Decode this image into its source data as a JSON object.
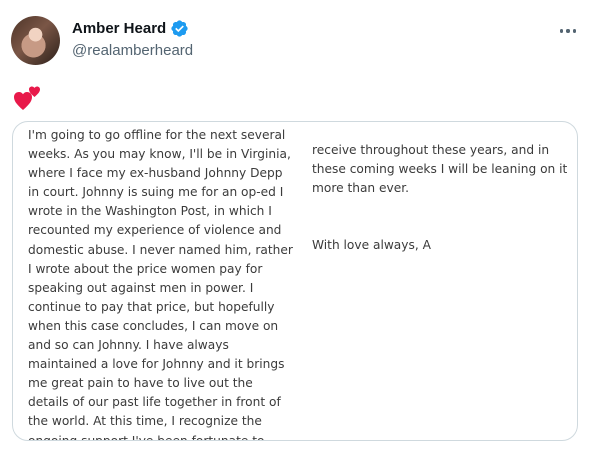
{
  "tweet": {
    "author": {
      "display_name": "Amber Heard",
      "handle": "@realamberheard",
      "verified": true,
      "verified_color": "#1d9bf0"
    },
    "text_icon": "two-hearts-icon",
    "more_icon": "more-options-icon",
    "statement": {
      "left_column": "I'm going to go offline for the next several\nweeks. As you may know,  I'll be in Virginia,\nwhere I face my ex-husband Johnny Depp\nin court. Johnny is suing me for an op-ed I\nwrote in the Washington Post, in which I\nrecounted my experience of violence and\ndomestic abuse. I never named him, rather\nI wrote about the price women pay for\nspeaking out against men in power. I\ncontinue to pay that price, but hopefully\nwhen this case concludes, I can move on\nand so can Johnny. I have always\nmaintained a love for Johnny and it brings\nme great pain to have to live out the\ndetails of our past life together in front of\nthe world. At this time, I recognize the\nongoing support I've been fortunate to",
      "right_column": "receive throughout these years, and in\nthese coming weeks I will be leaning on it\nmore than ever.",
      "signoff": "With love always, A"
    }
  }
}
